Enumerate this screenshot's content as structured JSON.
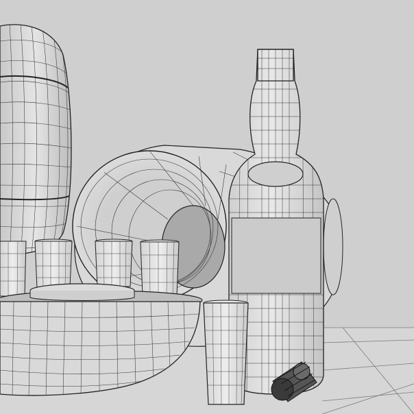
{
  "scene": {
    "description_tag": "wireframe-render",
    "colors": {
      "background": "#cfcfcf",
      "floor": "#d8d8d8",
      "shade_light": "#e6e6e6",
      "shade_mid": "#d2d2d2",
      "shade_dark": "#b8b8b8",
      "wire": "#222222",
      "label": "#cbcbcb"
    },
    "objects": [
      "barrel-upright",
      "barrel-lying",
      "shot-glass",
      "shot-glass",
      "shot-glass",
      "shot-glass",
      "glass-tray",
      "bottle",
      "bottle-cap",
      "tall-glass"
    ]
  }
}
